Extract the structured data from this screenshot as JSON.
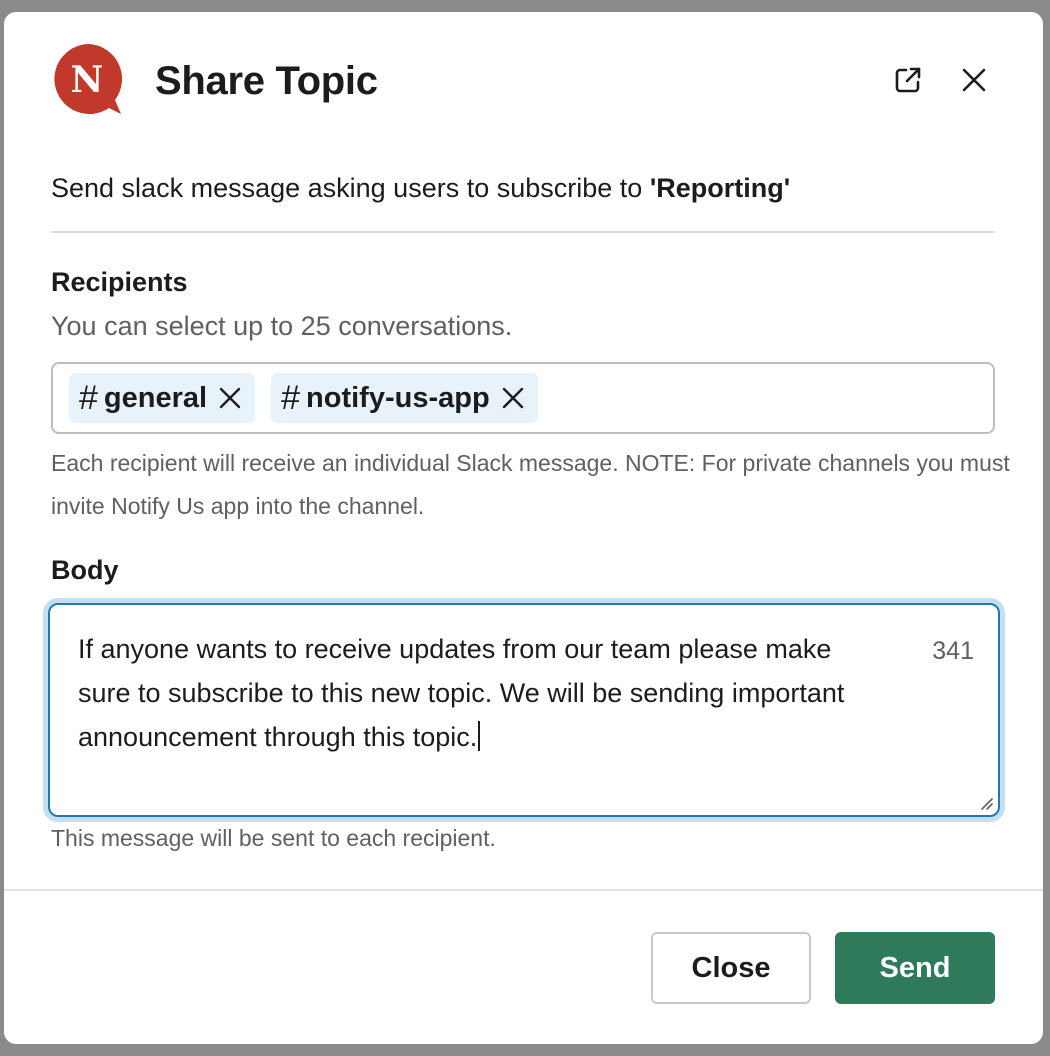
{
  "modal": {
    "title": "Share Topic",
    "logo_letter": "N",
    "popout_icon": "external-link-icon",
    "close_icon": "close-icon"
  },
  "intro": {
    "prefix": "Send slack message asking users to subscribe to ",
    "topic": "'Reporting'"
  },
  "recipients": {
    "label": "Recipients",
    "hint": "You can select up to 25 conversations.",
    "chips": [
      {
        "hash": "#",
        "name": "general"
      },
      {
        "hash": "#",
        "name": "notify-us-app"
      }
    ],
    "help": "Each recipient will receive an individual Slack message. NOTE: For private channels you must invite Notify Us app into the channel."
  },
  "body": {
    "label": "Body",
    "value": "If anyone wants to receive updates from our team please make sure to subscribe to this new topic. We will be sending important announcement through this topic.",
    "counter": "341",
    "hint": "This message will be sent to each recipient."
  },
  "footer": {
    "close_label": "Close",
    "send_label": "Send"
  },
  "colors": {
    "logo": "#c0392b",
    "send_button": "#2f7a5b",
    "focus_border": "#1d7ab5",
    "chip_bg": "#e8f2fa"
  }
}
